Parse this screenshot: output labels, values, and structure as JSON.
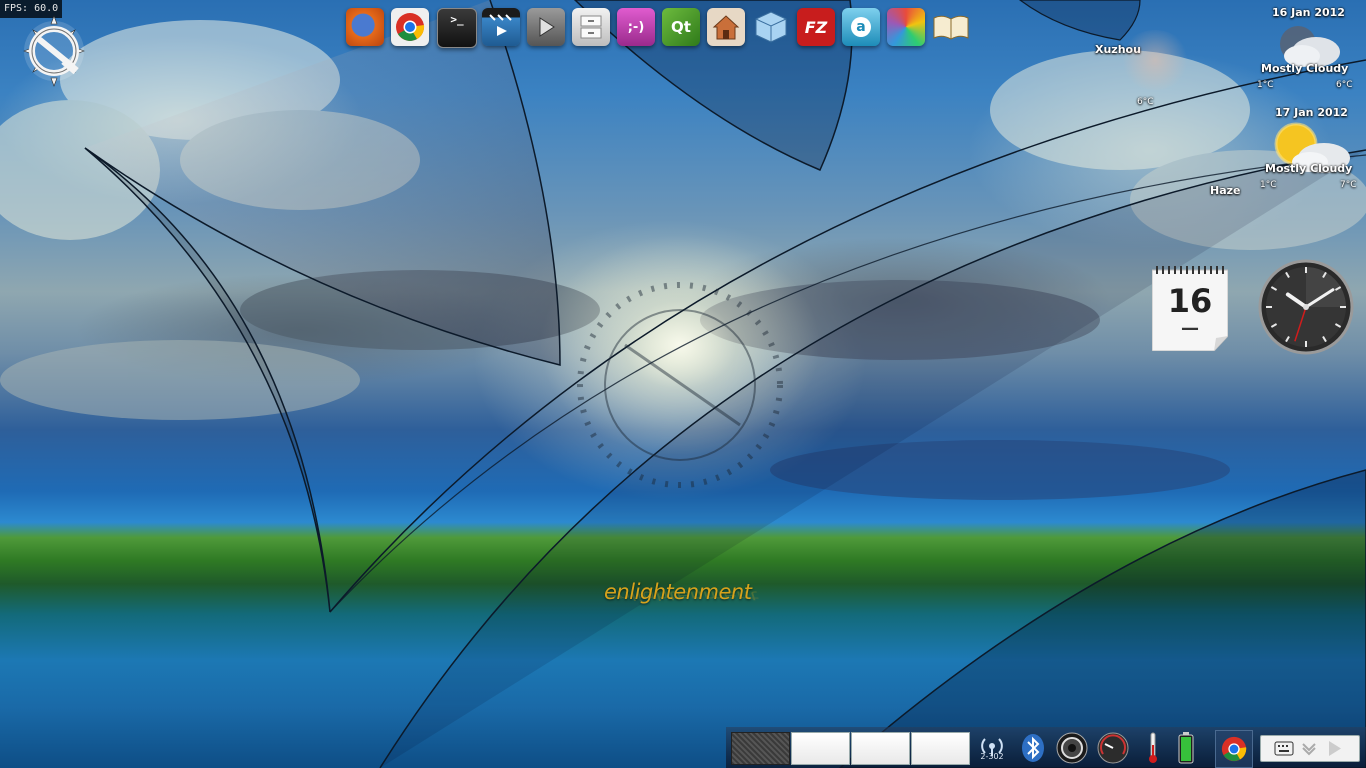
{
  "fps": {
    "label": "FPS: 60.0"
  },
  "launcher": {
    "items": [
      {
        "name": "firefox",
        "icon": "firefox-icon",
        "color": "#e66a1a",
        "glyph": ""
      },
      {
        "name": "chrome",
        "icon": "chrome-icon",
        "color": "#d9d9d9",
        "glyph": ""
      },
      {
        "name": "terminal",
        "icon": "terminal-icon",
        "color": "#2a2a2a",
        "glyph": ">_"
      },
      {
        "name": "video-editor",
        "icon": "clapperboard-icon",
        "color": "#2b5f8c",
        "glyph": ""
      },
      {
        "name": "media-player",
        "icon": "play-icon",
        "color": "#7a7a7a",
        "glyph": ""
      },
      {
        "name": "file-manager",
        "icon": "cabinet-icon",
        "color": "#d8d8d8",
        "glyph": ""
      },
      {
        "name": "messenger",
        "icon": "smiley-chat-icon",
        "color": "#c23fb0",
        "glyph": ";-)"
      },
      {
        "name": "qt-creator",
        "icon": "qt-icon",
        "color": "#4f9b2d",
        "glyph": "Qt"
      },
      {
        "name": "house-app",
        "icon": "house-icon",
        "color": "#d99a6c",
        "glyph": ""
      },
      {
        "name": "virtualbox",
        "icon": "cube-icon",
        "color": "#8fc1ea",
        "glyph": ""
      },
      {
        "name": "filezilla",
        "icon": "filezilla-icon",
        "color": "#c81d1d",
        "glyph": "FZ"
      },
      {
        "name": "chat-client",
        "icon": "search-chat-icon",
        "color": "#25a3c9",
        "glyph": "a"
      },
      {
        "name": "paint",
        "icon": "palette-icon",
        "color": "#e6b94a",
        "glyph": ""
      },
      {
        "name": "dictionary",
        "icon": "book-icon",
        "color": "#f1e6c8",
        "glyph": ""
      }
    ]
  },
  "weather": {
    "city1": "Xuzhou",
    "city1_temp": "6°C",
    "day1": {
      "date": "16 Jan 2012",
      "condition": "Mostly Cloudy",
      "low": "1°C",
      "high": "6°C"
    },
    "day2": {
      "date": "17 Jan 2012",
      "condition": "Mostly Cloudy",
      "low": "1°C",
      "high": "7°C"
    },
    "city2_condition": "Haze"
  },
  "calendar": {
    "day": "16",
    "dash": "—"
  },
  "clock": {
    "hour": 10,
    "minute": 9,
    "second": 33
  },
  "wallpaper": {
    "logo_text": "enlightenment"
  },
  "shelf": {
    "pager_desks": 4,
    "network_label": "2-302",
    "tray_icons": [
      "network-signal-icon",
      "bluetooth-icon",
      "mixer-icon",
      "cpufreq-icon",
      "temperature-icon",
      "battery-icon",
      "chrome-tray-icon"
    ],
    "keyboard_icon": "keyboard-icon"
  }
}
